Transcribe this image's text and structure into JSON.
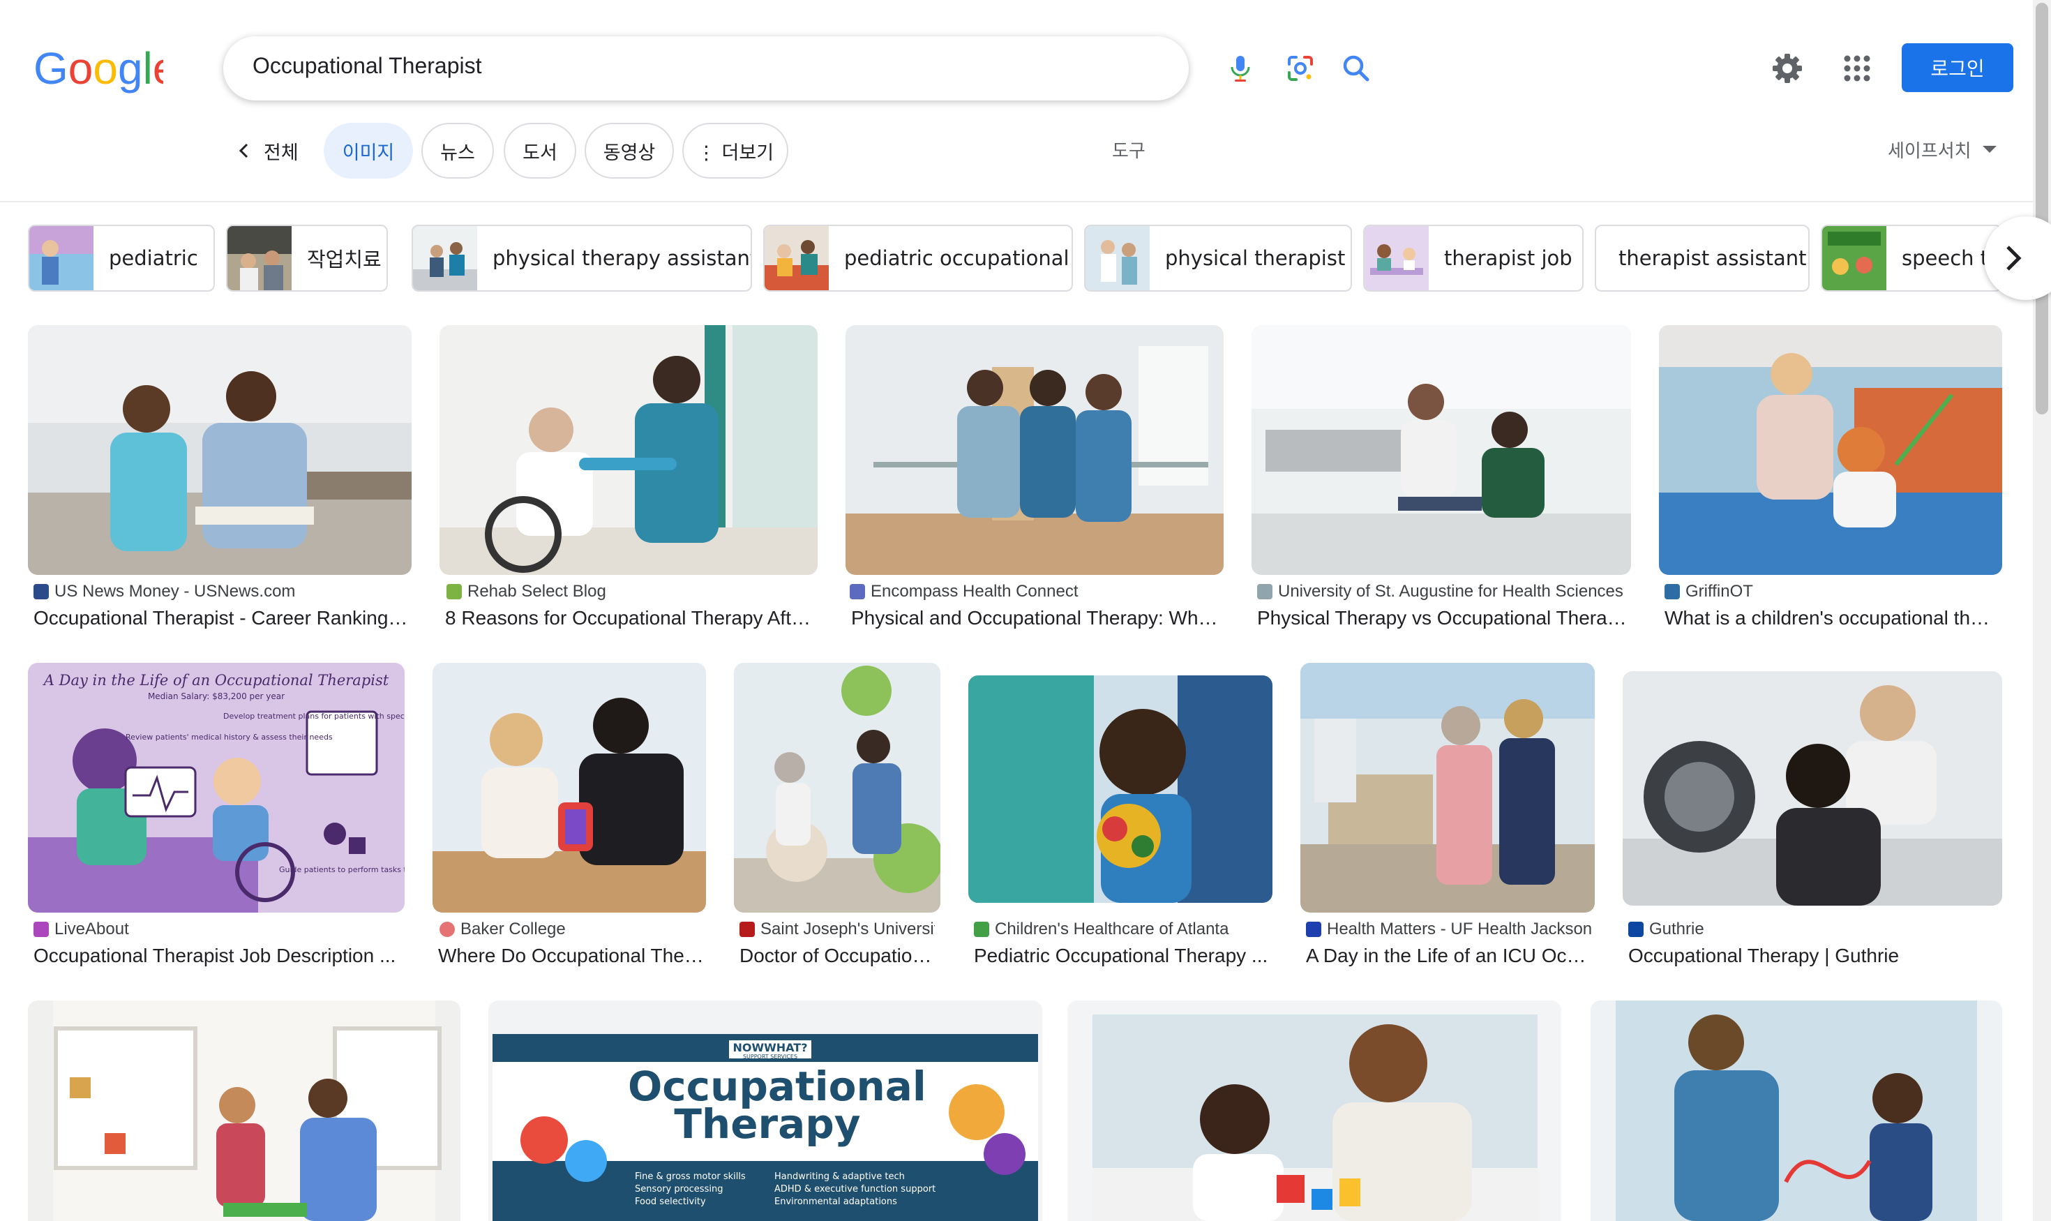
{
  "logo": {
    "text": "Google"
  },
  "search": {
    "query": "Occupational Therapist"
  },
  "header": {
    "login_label": "로그인"
  },
  "tabs": {
    "back_label": "전체",
    "items": [
      {
        "label": "이미지",
        "active": true
      },
      {
        "label": "뉴스",
        "active": false
      },
      {
        "label": "도서",
        "active": false
      },
      {
        "label": "동영상",
        "active": false
      },
      {
        "label": "⋮ 더보기",
        "active": false
      }
    ],
    "tools_label": "도구",
    "safesearch_label": "세이프서치"
  },
  "related": [
    {
      "label": "pediatric"
    },
    {
      "label": "작업치료"
    },
    {
      "label": "physical therapy assistant"
    },
    {
      "label": "pediatric occupational"
    },
    {
      "label": "physical therapist"
    },
    {
      "label": "therapist job"
    },
    {
      "label": "therapist assistant"
    },
    {
      "label": "speech t"
    }
  ],
  "results": [
    {
      "source": "US News Money - USNews.com",
      "title": "Occupational Therapist - Career Rankings, Salary, ..."
    },
    {
      "source": "Rehab Select Blog",
      "title": "8 Reasons for Occupational Therapy After ..."
    },
    {
      "source": "Encompass Health Connect",
      "title": "Physical and Occupational Therapy: What ..."
    },
    {
      "source": "University of St. Augustine for Health Sciences",
      "title": "Physical Therapy vs Occupational Therapy ..."
    },
    {
      "source": "GriffinOT",
      "title": "What is a children's occupational therapist ..."
    },
    {
      "source": "LiveAbout",
      "title": "Occupational Therapist Job Description ..."
    },
    {
      "source": "Baker College",
      "title": "Where Do Occupational Therapists Work ..."
    },
    {
      "source": "Saint Joseph's University",
      "title": "Doctor of Occupational Therapy ..."
    },
    {
      "source": "Children's Healthcare of Atlanta",
      "title": "Pediatric Occupational Therapy ..."
    },
    {
      "source": "Health Matters - UF Health Jacksonville",
      "title": "A Day in the Life of an ICU Occupational ..."
    },
    {
      "source": "Guthrie",
      "title": "Occupational Therapy | Guthrie"
    }
  ],
  "poster": {
    "title": "A Day in the Life of an Occupational Therapist",
    "salary": "Median Salary: $83,200 per year",
    "notes": [
      "Review patients' medical history & assess their needs",
      "Develop treatment plans for patients with specific goals",
      "Guide patients to perform tasks to meet their goals"
    ]
  },
  "banner": {
    "brand": "NOWWHAT?",
    "brand_sub": "SUPPORT SERVICES",
    "title_line1": "Occupational",
    "title_line2": "Therapy",
    "bullets_left": [
      "Fine & gross motor skills",
      "Sensory processing",
      "Food selectivity"
    ],
    "bullets_right": [
      "Handwriting & adaptive tech",
      "ADHD & executive function support",
      "Environmental adaptations"
    ]
  },
  "colors": {
    "accent": "#1a73e8",
    "active_tab_bg": "#e8f0fe",
    "active_tab_text": "#1967d2"
  }
}
